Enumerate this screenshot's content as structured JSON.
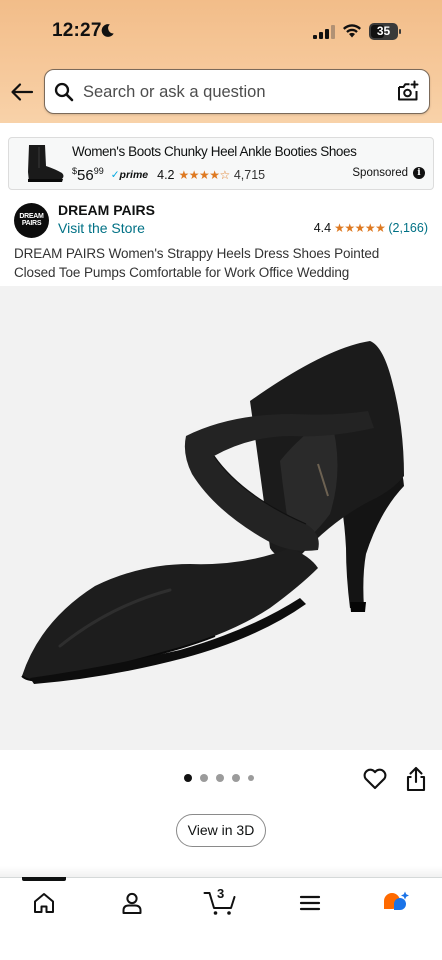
{
  "status_bar": {
    "time": "12:27",
    "battery": "35"
  },
  "search": {
    "placeholder": "Search or ask a question"
  },
  "sponsored_ad": {
    "title": "Women's Boots Chunky Heel Ankle Booties Shoes",
    "price_currency": "$",
    "price_dollars": "56",
    "price_cents": "99",
    "prime_label": "prime",
    "rating": "4.2",
    "stars": "★★★★☆",
    "review_count": "4,715",
    "sponsored_label": "Sponsored",
    "info_glyph": "i"
  },
  "brand": {
    "logo_line1": "DREAM",
    "logo_line2": "PAIRS",
    "name": "DREAM PAIRS",
    "visit_store": "Visit the Store",
    "rating": "4.4",
    "stars": "★★★★★",
    "review_count": "(2,166)"
  },
  "product": {
    "title": "DREAM PAIRS Women's Strappy Heels Dress Shoes Pointed Closed Toe Pumps Comfortable for Work Office Wedding",
    "image_total": 5,
    "image_index": 1
  },
  "actions": {
    "view_3d_label": "View in 3D"
  },
  "tab_bar": {
    "cart_count": "3",
    "tabs": [
      "home",
      "account",
      "cart",
      "menu",
      "rufus"
    ]
  },
  "icons": {
    "back": "arrow-left-icon",
    "search": "magnifier-icon",
    "camera": "camera-search-icon",
    "heart": "heart-icon",
    "share": "share-icon"
  },
  "colors": {
    "header_bg": "#f6c89a",
    "link": "#007185",
    "star": "#de7921",
    "prime_check": "#00a8e1",
    "rufus_orange": "#ff6a00",
    "rufus_blue": "#1a73e8"
  }
}
